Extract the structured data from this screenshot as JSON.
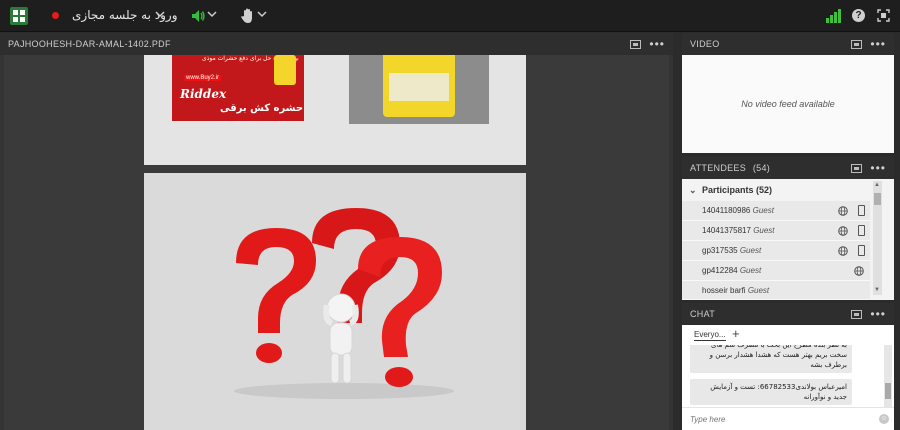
{
  "topbar": {
    "meeting_title": "ورود به جلسه مجازی",
    "icons": [
      "app-grid-icon",
      "record-icon",
      "speaker-icon",
      "raise-hand-icon",
      "signal-icon",
      "help-icon",
      "fullscreen-icon"
    ]
  },
  "share_pod": {
    "title": "PAJHOOHESH-DAR-AMAL-1402.PDF",
    "slide_top": {
      "riddex_brand": "Riddex",
      "riddex_caption": "حشره کش برقی",
      "riddex_site": "www.Buy2.ir",
      "riddex_tagline": "بهترین راه حل برای دفع حشرات موذی"
    }
  },
  "video_pod": {
    "title": "VIDEO",
    "empty_text": "No video feed available"
  },
  "attendees_pod": {
    "title": "ATTENDEES",
    "count": "(54)",
    "group_label": "Participants (52)",
    "rows": [
      {
        "name": "14041180986",
        "role": "Guest"
      },
      {
        "name": "14041375817",
        "role": "Guest"
      },
      {
        "name": "gp317535",
        "role": "Guest"
      },
      {
        "name": "gp412284",
        "role": "Guest"
      },
      {
        "name": "hosseir barfi",
        "role": "Guest"
      }
    ]
  },
  "chat_pod": {
    "title": "CHAT",
    "tab_everyone": "Everyo...",
    "tab_add": "+",
    "messages": [
      "به نظر بنده مطرح این بحث با مصرف سم های سخت بریم بهتر هست که هشدا هشدار برسن و برطرف بشه",
      "امیرعباس بولاندی66782533: تست و آزمایش جدید و نوآورانه"
    ],
    "input_placeholder": "Type here"
  },
  "colors": {
    "topbar_bg": "#1e1e1e",
    "record": "#e21d1d",
    "speaker_active": "#2fbf3a",
    "signal": "#3fbf3a",
    "question_marks": "#e21919"
  }
}
